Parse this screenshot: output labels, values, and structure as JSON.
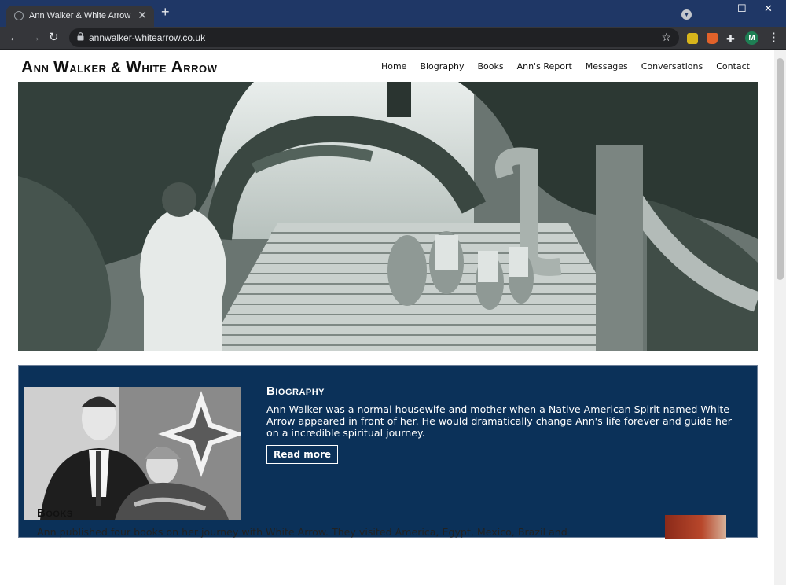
{
  "browser": {
    "tab_title": "Ann Walker & White Arrow",
    "tab_close": "✕",
    "new_tab": "+",
    "url": "annwalker-whitearrow.co.uk",
    "profile_initial": "M",
    "window_min": "—",
    "window_max": "☐",
    "window_close": "✕"
  },
  "site": {
    "title_prefix_a": "A",
    "title_rest_a": "nn ",
    "title_prefix_w": "W",
    "title_rest_w": "alker & ",
    "title_prefix_w2": "W",
    "title_rest_w2": "hite ",
    "title_prefix_ar": "A",
    "title_rest_ar": "rrow"
  },
  "nav": {
    "items": [
      "Home",
      "Biography",
      "Books",
      "Ann's Report",
      "Messages",
      "Conversations",
      "Contact"
    ]
  },
  "biography": {
    "heading": "Biography",
    "text": "Ann Walker was a normal housewife and mother when a Native American Spirit named White Arrow appeared in front of her. He would dramatically change Ann's life forever and guide her on a incredible spiritual journey.",
    "button": "Read more"
  },
  "books": {
    "heading": "Books",
    "text": "Ann published four books on her journey with White Arrow. They visited America, Egypt, Mexico, Brazil and"
  },
  "colors": {
    "tabbar": "#1f3766",
    "toolbar": "#35363a",
    "bio_bg": "#0b3159"
  }
}
